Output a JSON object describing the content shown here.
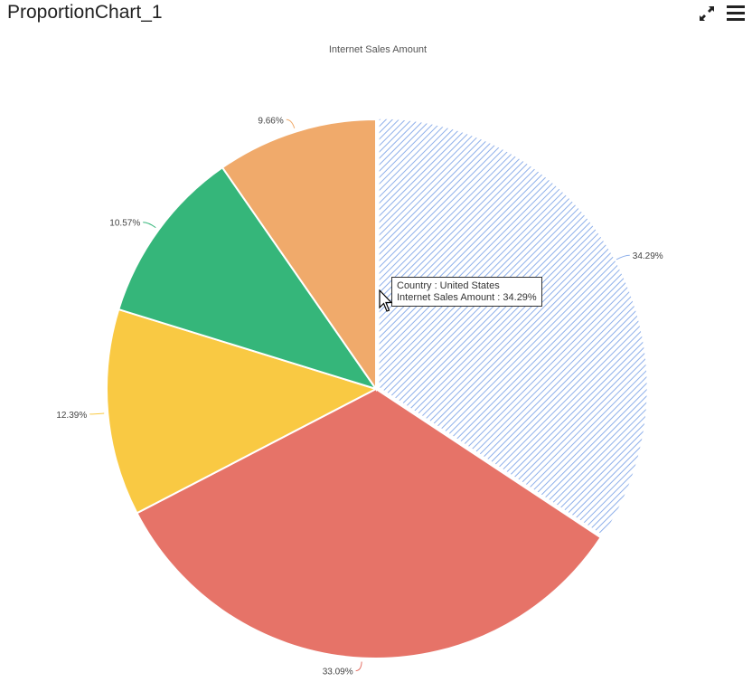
{
  "header": {
    "title": "ProportionChart_1",
    "expand_icon": "expand-icon",
    "menu_icon": "hamburger-menu-icon"
  },
  "chart_data": {
    "type": "pie",
    "title": "Internet Sales Amount",
    "categories": [
      "United States",
      "",
      "",
      "",
      ""
    ],
    "values": [
      34.29,
      33.09,
      12.39,
      10.57,
      9.66
    ],
    "labels": [
      "34.29%",
      "33.09%",
      "12.39%",
      "10.57%",
      "9.66%"
    ],
    "colors": [
      "#a9c2ef",
      "#e67368",
      "#f9c943",
      "#35b67a",
      "#f0aa6b"
    ],
    "highlighted_index": 0,
    "start_angle": "12 o'clock, clockwise"
  },
  "tooltip": {
    "line1": "Country : United States",
    "line2": "Internet Sales Amount : 34.29%"
  }
}
